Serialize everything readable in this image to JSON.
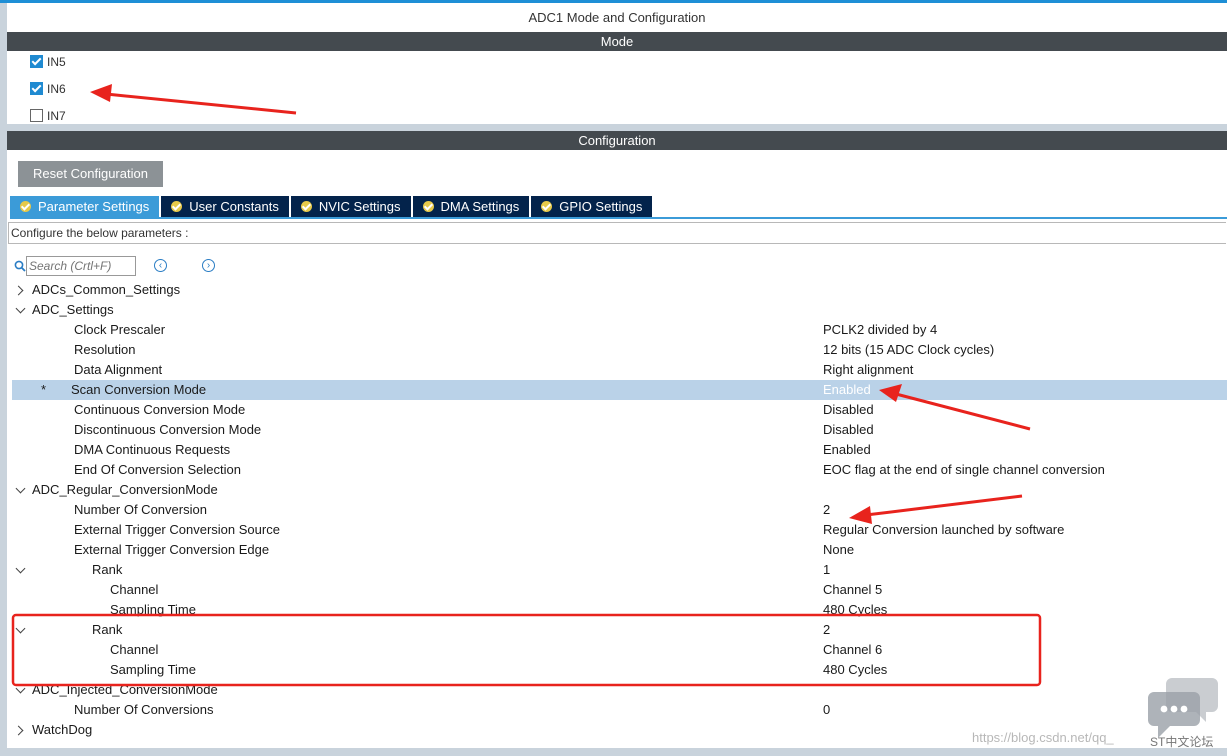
{
  "window": {
    "title": "ADC1 Mode and Configuration"
  },
  "mode": {
    "header": "Mode",
    "channels": [
      {
        "label": "IN5",
        "checked": true
      },
      {
        "label": "IN6",
        "checked": true
      },
      {
        "label": "IN7",
        "checked": false
      }
    ]
  },
  "configuration": {
    "header": "Configuration",
    "reset_label": "Reset Configuration",
    "tabs": [
      {
        "label": "Parameter Settings",
        "active": true
      },
      {
        "label": "User Constants",
        "active": false
      },
      {
        "label": "NVIC Settings",
        "active": false
      },
      {
        "label": "DMA Settings",
        "active": false
      },
      {
        "label": "GPIO Settings",
        "active": false
      }
    ],
    "note": "Configure the below parameters :",
    "search_placeholder": "Search (Crtl+F)",
    "tree": [
      {
        "label": "ADCs_Common_Settings",
        "value": ""
      },
      {
        "label": "ADC_Settings",
        "value": ""
      },
      {
        "label": "Clock Prescaler",
        "value": "PCLK2 divided by 4"
      },
      {
        "label": "Resolution",
        "value": "12 bits (15 ADC Clock cycles)"
      },
      {
        "label": "Data Alignment",
        "value": "Right alignment"
      },
      {
        "label": "Scan Conversion Mode",
        "value": "Enabled",
        "star": "*"
      },
      {
        "label": "Continuous Conversion Mode",
        "value": "Disabled"
      },
      {
        "label": "Discontinuous Conversion Mode",
        "value": "Disabled"
      },
      {
        "label": "DMA Continuous Requests",
        "value": "Enabled"
      },
      {
        "label": "End Of Conversion Selection",
        "value": "EOC flag at the end of single channel conversion"
      },
      {
        "label": "ADC_Regular_ConversionMode",
        "value": ""
      },
      {
        "label": "Number Of Conversion",
        "value": "2"
      },
      {
        "label": "External Trigger Conversion Source",
        "value": "Regular Conversion launched by software"
      },
      {
        "label": "External Trigger Conversion Edge",
        "value": "None"
      },
      {
        "label": "Rank",
        "value": "1"
      },
      {
        "label": "Channel",
        "value": "Channel 5"
      },
      {
        "label": "Sampling Time",
        "value": "480 Cycles"
      },
      {
        "label": "Rank",
        "value": "2"
      },
      {
        "label": "Channel",
        "value": "Channel 6"
      },
      {
        "label": "Sampling Time",
        "value": "480 Cycles"
      },
      {
        "label": "ADC_Injected_ConversionMode",
        "value": ""
      },
      {
        "label": "Number Of Conversions",
        "value": "0"
      },
      {
        "label": "WatchDog",
        "value": ""
      }
    ]
  },
  "watermark": {
    "url": "https://blog.csdn.net/qq_",
    "label": "ST中文论坛"
  },
  "colors": {
    "accent": "#3b9bd8",
    "header_bg": "#444a4f",
    "tab_bg": "#03234b",
    "selection": "#bad2e8",
    "annotation": "#e8231d"
  }
}
